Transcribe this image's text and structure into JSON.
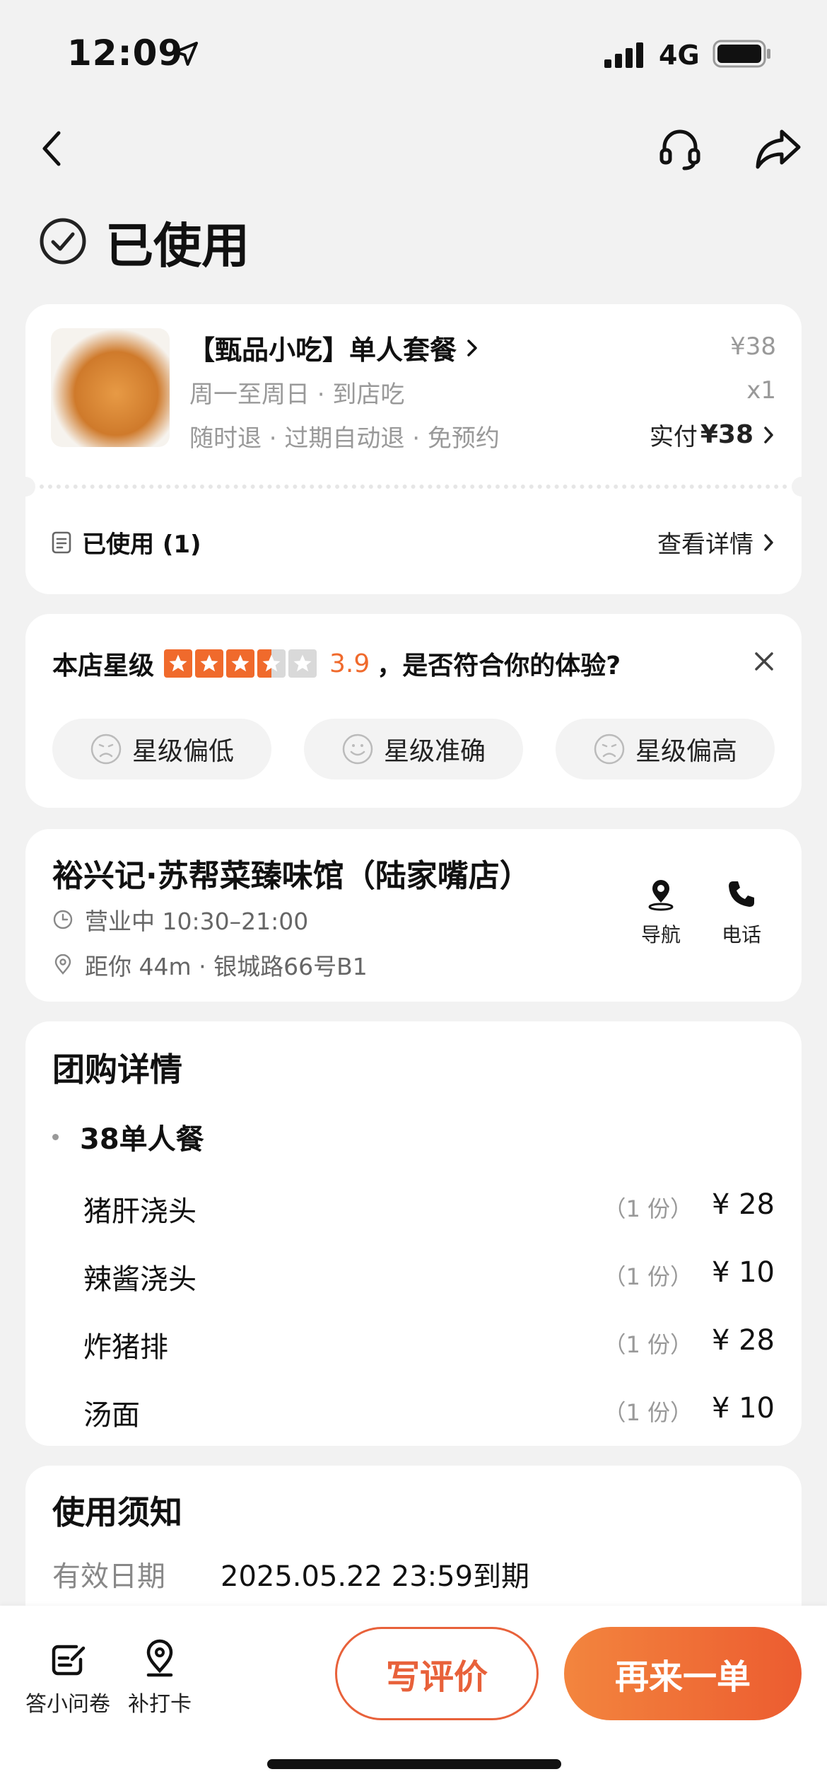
{
  "status_bar": {
    "time": "12:09",
    "network": "4G"
  },
  "page": {
    "status_title": "已使用"
  },
  "order": {
    "name": "【甄品小吃】单人套餐",
    "sub1": "周一至周日 · 到店吃",
    "sub2": "随时退 · 过期自动退 · 免预约",
    "price": "¥38",
    "qty": "x1",
    "paid_label": "实付",
    "paid_amount": "¥38",
    "used_label": "已使用 (1)",
    "detail_link": "查看详情"
  },
  "rating": {
    "label": "本店星级",
    "stars": 3.5,
    "score": "3.9",
    "question": "，是否符合你的体验?",
    "options": [
      "星级偏低",
      "星级准确",
      "星级偏高"
    ]
  },
  "shop": {
    "name": "裕兴记·苏帮菜臻味馆（陆家嘴店）",
    "hours": "营业中 10:30–21:00",
    "distance": "距你 44m · 银城路66号B1",
    "nav_label": "导航",
    "call_label": "电话"
  },
  "package": {
    "title": "团购详情",
    "group": "38单人餐",
    "items": [
      {
        "name": "猪肝浇头",
        "count": "（1 份）",
        "price": "¥ 28"
      },
      {
        "name": "辣酱浇头",
        "count": "（1 份）",
        "price": "¥ 10"
      },
      {
        "name": "炸猪排",
        "count": "（1 份）",
        "price": "¥ 28"
      },
      {
        "name": "汤面",
        "count": "（1 份）",
        "price": "¥ 10"
      }
    ]
  },
  "usage": {
    "title": "使用须知",
    "valid_label": "有效日期",
    "valid_value": "2025.05.22 23:59到期"
  },
  "bottom": {
    "survey_label": "答小问卷",
    "checkin_label": "补打卡",
    "review_button": "写评价",
    "reorder_button": "再来一单"
  },
  "colors": {
    "accent": "#f06a2c",
    "button_gradient_start": "#f3853e",
    "button_gradient_end": "#ec5c30"
  }
}
